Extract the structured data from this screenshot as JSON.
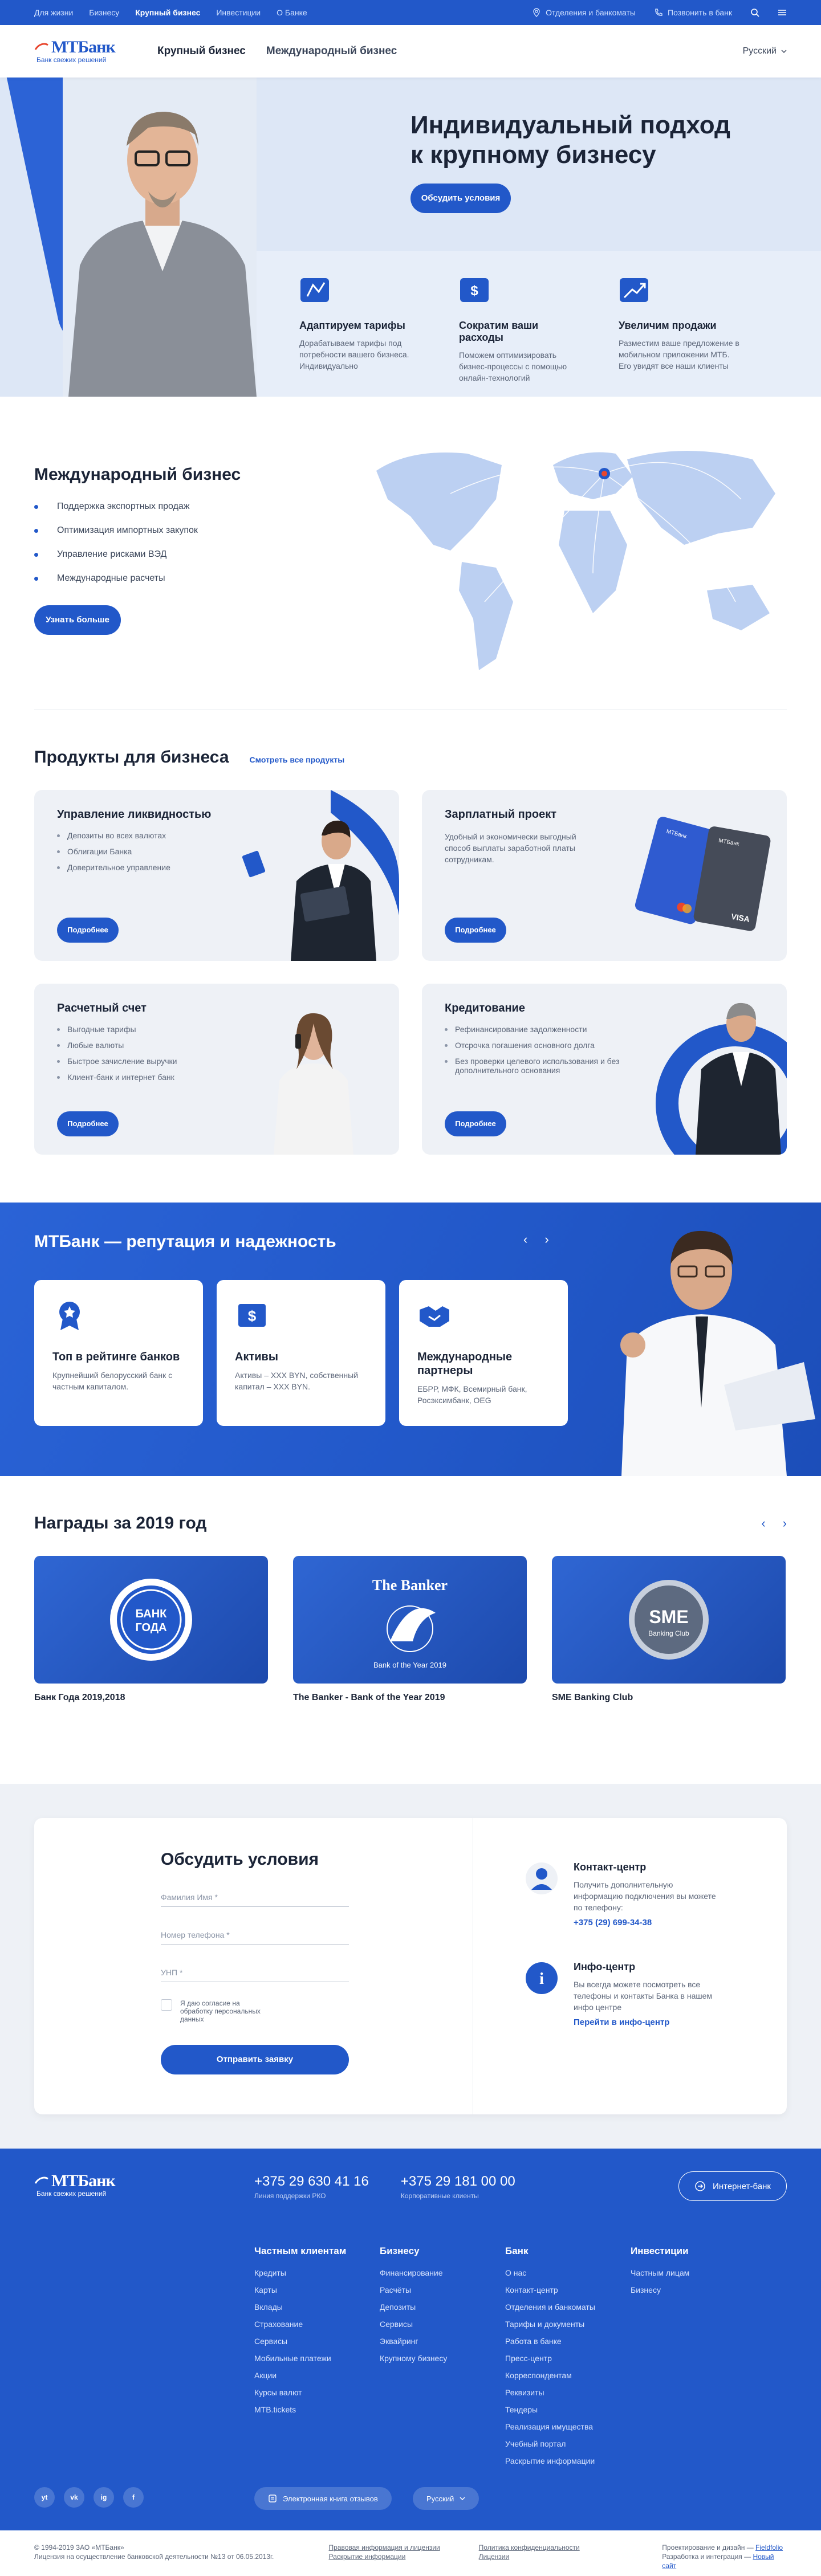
{
  "topbar": {
    "links": [
      "Для жизни",
      "Бизнесу",
      "Крупный бизнес",
      "Инвестиции",
      "О Банке"
    ],
    "branches": "Отделения и банкоматы",
    "call": "Позвонить в банк"
  },
  "header": {
    "logo": "МТБанк",
    "slogan": "Банк свежих решений",
    "nav": [
      "Крупный бизнес",
      "Международный бизнес"
    ],
    "lang": "Русский"
  },
  "hero": {
    "title_1": "Индивидуальный подход",
    "title_2": "к крупному бизнесу",
    "button": "Обсудить условия",
    "features": [
      {
        "title": "Адаптируем тарифы",
        "text": "Дорабатываем тарифы под потребности вашего бизнеса. Индивидуально"
      },
      {
        "title": "Сократим ваши расходы",
        "text": "Поможем оптимизировать бизнес-процессы с помощью онлайн-технологий"
      },
      {
        "title": "Увеличим продажи",
        "text": "Разместим ваше предложение в мобильном приложении МТБ. Его увидят все наши клиенты"
      }
    ]
  },
  "intl": {
    "title": "Международный бизнес",
    "items": [
      "Поддержка экспортных продаж",
      "Оптимизация импортных закупок",
      "Управление рисками ВЭД",
      "Международные расчеты"
    ],
    "button": "Узнать больше"
  },
  "products": {
    "title": "Продукты для бизнеса",
    "all_link": "Смотреть все продукты",
    "details": "Подробнее",
    "cards": [
      {
        "title": "Управление ликвидностью",
        "items": [
          "Депозиты во всех валютах",
          "Облигации Банка",
          "Доверительное управление"
        ]
      },
      {
        "title": "Зарплатный проект",
        "text": "Удобный и экономически выгодный способ выплаты заработной платы сотрудникам."
      },
      {
        "title": "Расчетный счет",
        "items": [
          "Выгодные тарифы",
          "Любые валюты",
          "Быстрое зачисление выручки",
          "Клиент-банк и интернет банк"
        ]
      },
      {
        "title": "Кредитование",
        "items": [
          "Рефинансирование задолженности",
          "Отсрочка погашения основного долга",
          "Без проверки целевого использования и без дополнительного основания"
        ]
      }
    ],
    "card_visa": "VISA",
    "card_brand": "МТБанк"
  },
  "reputation": {
    "title": "МТБанк — репутация и надежность",
    "cards": [
      {
        "title": "Топ в рейтинге банков",
        "text": "Крупнейший белорусский банк с частным капиталом."
      },
      {
        "title": "Активы",
        "text": "Активы – XXX BYN, собственный капитал – XXX BYN."
      },
      {
        "title": "Международные партнеры",
        "text": "ЕБРР, МФК, Всемирный банк, Росэксимбанк, OEG"
      }
    ]
  },
  "awards": {
    "title": "Награды за 2019 год",
    "items": [
      {
        "caption": "Банк Года 2019,2018",
        "badge_1": "БАНК",
        "badge_2": "ГОДА"
      },
      {
        "caption": "The Banker - Bank of the Year 2019",
        "badge_1": "The Banker",
        "badge_2": "Bank of the Year 2019"
      },
      {
        "caption": "SME Banking Club",
        "badge_1": "SME",
        "badge_2": "Banking Club"
      }
    ]
  },
  "form": {
    "title": "Обсудить условия",
    "name_placeholder": "Фамилия Имя *",
    "phone_placeholder": "Номер телефона *",
    "unp_placeholder": "УНП *",
    "agree": "Я даю согласие на обработку персональных данных",
    "submit": "Отправить заявку",
    "contact_title": "Контакт-центр",
    "contact_text": "Получить дополнительную информацию подключения вы можете по телефону:",
    "contact_phone": "+375 (29) 699-34-38",
    "info_title": "Инфо-центр",
    "info_text": "Вы всегда можете посмотреть все телефоны и контакты Банка в нашем инфо центре",
    "info_link": "Перейти в инфо-центр"
  },
  "footer": {
    "phone_1": "+375 29 630 41 16",
    "phone_1_label": "Линия поддержки РКО",
    "phone_2": "+375 29 181 00 00",
    "phone_2_label": "Корпоративные клиенты",
    "ibank": "Интернет-банк",
    "columns": [
      {
        "title": "Частным клиентам",
        "items": [
          "Кредиты",
          "Карты",
          "Вклады",
          "Страхование",
          "Сервисы",
          "Мобильные платежи",
          "Акции",
          "Курсы валют",
          "MTB.tickets"
        ]
      },
      {
        "title": "Бизнесу",
        "items": [
          "Финансирование",
          "Расчёты",
          "Депозиты",
          "Сервисы",
          "Эквайринг",
          "Крупному бизнесу"
        ]
      },
      {
        "title": "Банк",
        "items": [
          "О нас",
          "Контакт-центр",
          "Отделения и банкоматы",
          "Тарифы и документы",
          "Работа в банке",
          "Пресс-центр",
          "Корреспондентам",
          "Реквизиты",
          "Тендеры",
          "Реализация имущества",
          "Учебный портал",
          "Раскрытие информации"
        ]
      },
      {
        "title": "Инвестиции",
        "items": [
          "Частным лицам",
          "Бизнесу"
        ]
      }
    ],
    "social": [
      "yt",
      "vk",
      "ig",
      "f"
    ],
    "book": "Электронная книга отзывов",
    "lang": "Русский"
  },
  "legal": {
    "copyright": "© 1994-2019 ЗАО «МТБанк»",
    "license": "Лицензия на осуществление банковской деятельности №13 от 06.05.2013г.",
    "link_1": "Правовая информация и лицензии",
    "link_2": "Раскрытие информации",
    "link_3": "Политика конфиденциальности",
    "link_4": "Лицензии",
    "design": "Проектирование и дизайн — ",
    "design_by": "Fieldfolio",
    "dev": "Разработка и интеграция — ",
    "dev_by": "Новый сайт"
  }
}
